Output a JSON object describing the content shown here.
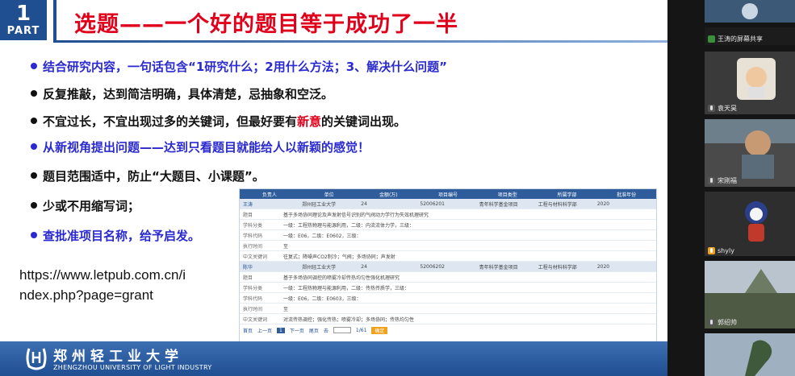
{
  "slide": {
    "part_badge": {
      "number": "1",
      "word": "PART"
    },
    "title": "选题——一个好的题目等于成功了一半",
    "bullets": [
      {
        "text": "结合研究内容，一句话包含“1研究什么；2用什么方法；3、解决什么问题”",
        "style": "blue"
      },
      {
        "text": "反复推敲，达到简洁明确，具体清楚，忌抽象和空泛。",
        "style": "black"
      },
      {
        "text_before": "不宜过长，不宜出现过多的关键词，但最好要有",
        "highlight": "新意",
        "text_after": "的关键词出现。",
        "style": "black"
      },
      {
        "text": "从新视角提出问题——达到只看题目就能给人以新颖的感觉！",
        "style": "blue"
      },
      {
        "text": "题目范围适中，防止“大题目、小课题”。",
        "style": "black"
      },
      {
        "text": "少或不用缩写词；",
        "style": "black"
      },
      {
        "text": "查批准项目名称，给予启发。",
        "style": "blue"
      }
    ],
    "url_line1": "https://www.letpub.com.cn/i",
    "url_line2": "ndex.php?page=grant"
  },
  "grant_table": {
    "columns": [
      "负责人",
      "单位",
      "金额(万)",
      "项目编号",
      "项目类型",
      "所属学部",
      "批准年份"
    ],
    "records": [
      {
        "main": [
          "王涛",
          "郑州轻工业大学",
          "24",
          "52006201",
          "青年科学基金项目",
          "工程与材料科学部",
          "2020"
        ],
        "details": [
          {
            "label": "题目",
            "value": "基于多场协同理论及声发射信号识别的气阀动力学行为失效机理研究"
          },
          {
            "label": "学科分类",
            "value": "一级：工程热物理与能源利用，二级：内流流体力学，三级："
          },
          {
            "label": "学科代码",
            "value": "一级：E06，二级：E0602，三级："
          },
          {
            "label": "执行时间",
            "value": "至"
          },
          {
            "label": "中文关键词",
            "value": "往复式；降噪声CO2制冷；气阀；多场协同；声发射"
          }
        ]
      },
      {
        "main": [
          "陈华",
          "郑州轻工业大学",
          "24",
          "52006202",
          "青年科学基金项目",
          "工程与材料科学部",
          "2020"
        ],
        "details": [
          {
            "label": "题目",
            "value": "基于多场协同调控的喷雾冷却传热均匀性强化机理研究"
          },
          {
            "label": "学科分类",
            "value": "一级：工程热物理与能源利用，二级：传热传质学，三级："
          },
          {
            "label": "学科代码",
            "value": "一级：E06，二级：E0603，三级："
          },
          {
            "label": "执行时间",
            "value": "至"
          },
          {
            "label": "中文关键词",
            "value": "对流传热调控；强化传热；喷雾冷却；多场协同；传热均匀性"
          }
        ]
      }
    ],
    "pager": {
      "first": "首页",
      "prev": "上一页",
      "current": "1",
      "next": "下一页",
      "last": "尾页",
      "goto": "去",
      "pages": "1/61",
      "go_button": "确定"
    }
  },
  "footer": {
    "university_cn": "郑州轻工业大学",
    "university_en": "ZHENGZHOU UNIVERSITY OF LIGHT INDUSTRY"
  },
  "participants": [
    {
      "name": "",
      "mic": "none"
    },
    {
      "name": "王涛的屏幕共享",
      "mic": "share"
    },
    {
      "name": "袁天昊",
      "mic": "off"
    },
    {
      "name": "宋刚福",
      "mic": "off"
    },
    {
      "name": "shyly",
      "mic": "on"
    },
    {
      "name": "郭绍帅",
      "mic": "off"
    },
    {
      "name": "",
      "mic": "none"
    }
  ],
  "colors": {
    "slide_blue": "#1f4e91",
    "title_red": "#e0001b",
    "bullet_blue": "#2a2ad0",
    "panel_bg": "#151515"
  }
}
